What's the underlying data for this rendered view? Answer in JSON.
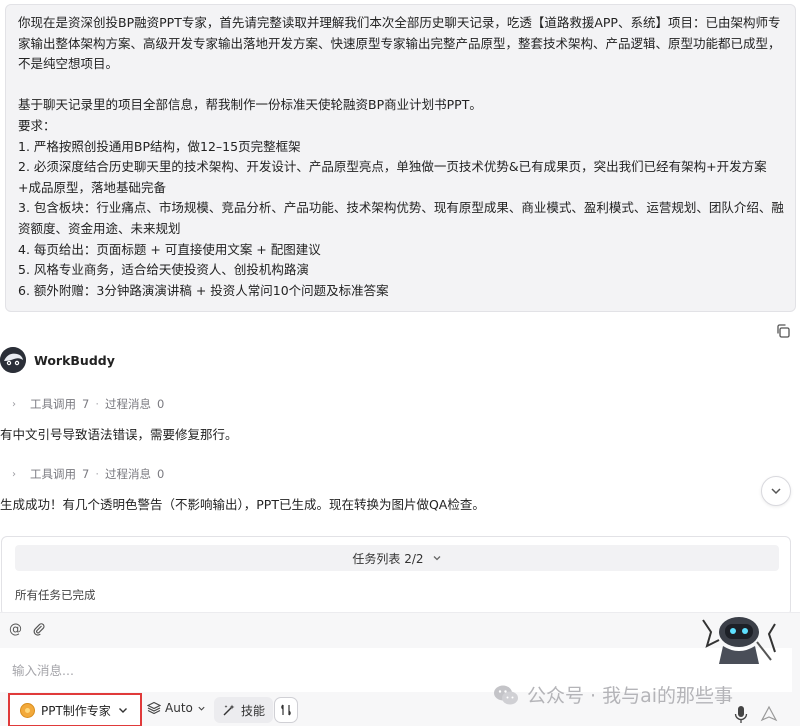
{
  "user_message": {
    "lines": [
      "你现在是资深创投BP融资PPT专家，首先请完整读取并理解我们本次全部历史聊天记录，吃透【道路救援APP、系统】项目：已由架构师专家输出整体架构方案、高级开发专家输出落地开发方案、快速原型专家输出完整产品原型，整套技术架构、产品逻辑、原型功能都已成型，不是纯空想项目。",
      "",
      "基于聊天记录里的项目全部信息，帮我制作一份标准天使轮融资BP商业计划书PPT。",
      "要求：",
      "1. 严格按照创投通用BP结构，做12–15页完整框架",
      "2. 必须深度结合历史聊天里的技术架构、开发设计、产品原型亮点，单独做一页技术优势&已有成果页，突出我们已经有架构+开发方案+成品原型，落地基础完备",
      "3. 包含板块：行业痛点、市场规模、竞品分析、产品功能、技术架构优势、现有原型成果、商业模式、盈利模式、运营规划、团队介绍、融资额度、资金用途、未来规划",
      "4. 每页给出：页面标题 + 可直接使用文案 + 配图建议",
      "5. 风格专业商务，适合给天使投资人、创投机构路演",
      "6. 额外附赠：3分钟路演演讲稿 + 投资人常问10个问题及标准答案"
    ]
  },
  "assistant": {
    "name": "WorkBuddy",
    "steps": [
      {
        "tool_label": "工具调用",
        "tool_count": "7",
        "process_label": "过程消息",
        "process_count": "0",
        "message": "有中文引号导致语法错误，需要修复那行。"
      },
      {
        "tool_label": "工具调用",
        "tool_count": "7",
        "process_label": "过程消息",
        "process_count": "0",
        "message": "生成成功！有几个透明色警告（不影响输出），PPT已生成。现在转换为图片做QA检查。"
      }
    ]
  },
  "task_list": {
    "title": "任务列表 2/2",
    "status": "所有任务已完成"
  },
  "composer": {
    "placeholder": "输入消息...",
    "mode_label": "PPT制作专家",
    "model_label": "Auto",
    "skill_label": "技能"
  },
  "watermark": {
    "text": "公众号 · 我与ai的那些事"
  },
  "colors": {
    "highlight_border": "#e03a3a",
    "bubble_bg": "#f3f3f5",
    "muted_text": "#7a7a80"
  },
  "icons": {
    "copy": "copy-icon",
    "chevron": "chevron-right-icon",
    "scroll": "chevron-down-icon",
    "at": "at-icon",
    "attach": "paperclip-icon",
    "layers": "layers-icon",
    "skill": "wand-icon",
    "mic": "mic-icon",
    "send": "send-icon"
  }
}
